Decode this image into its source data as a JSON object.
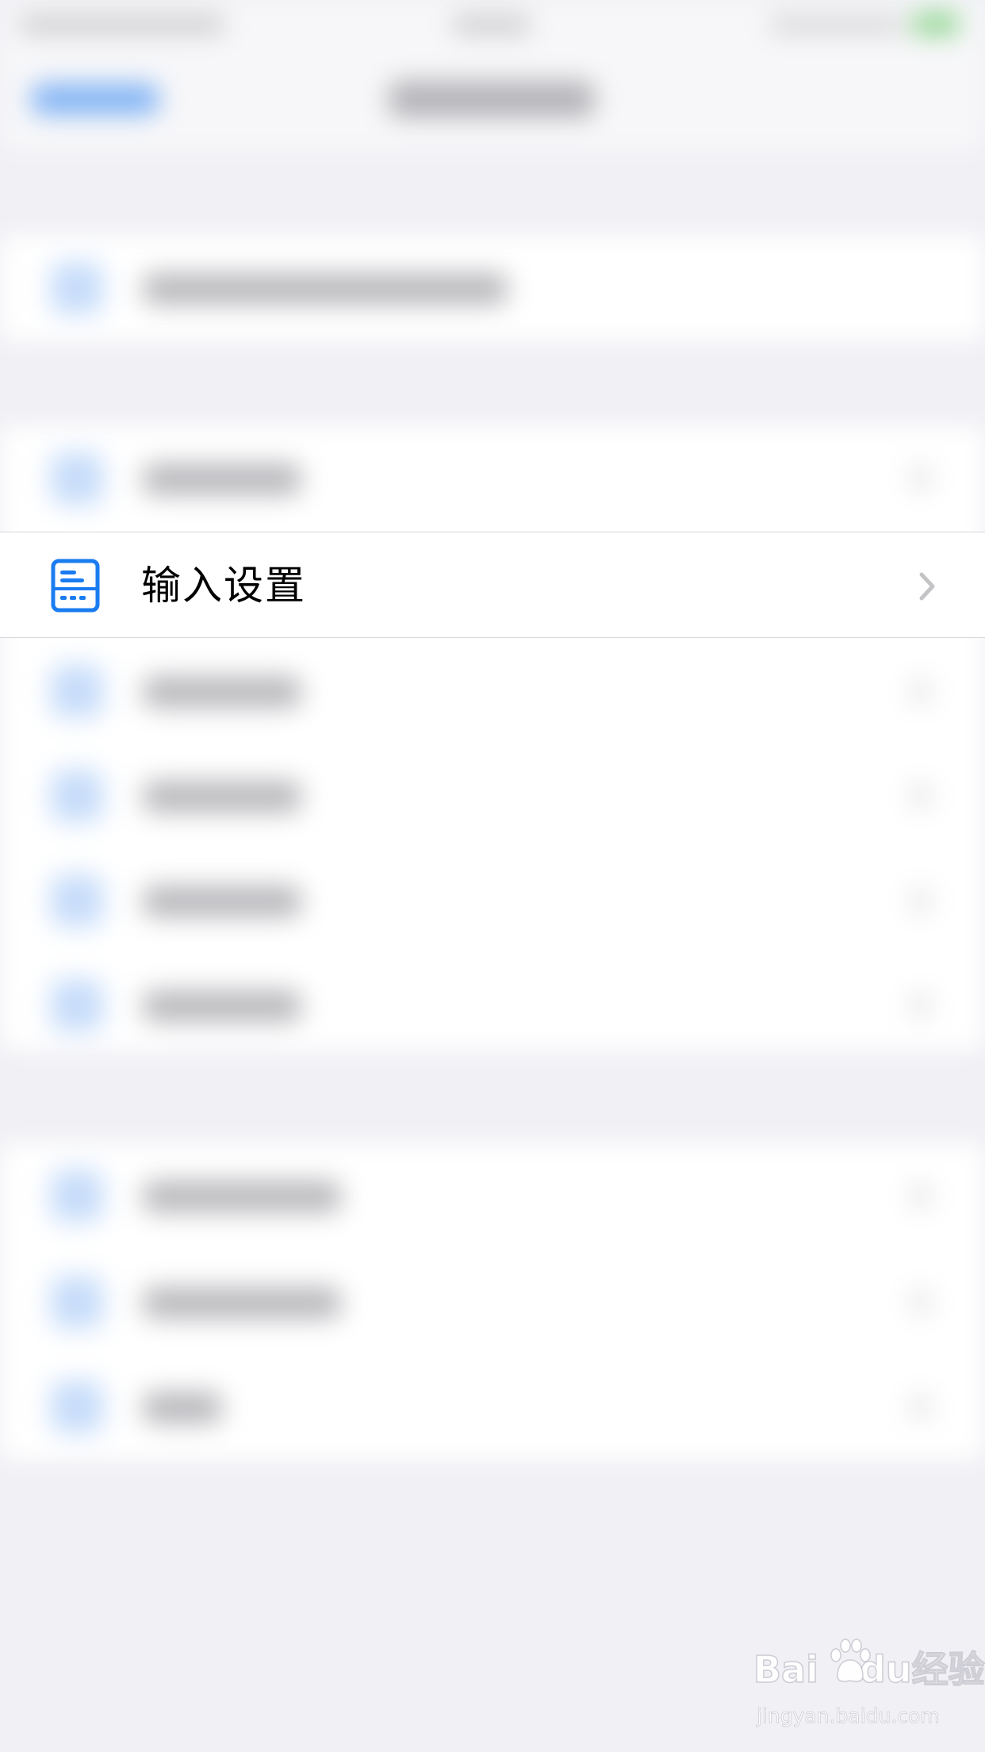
{
  "focused_row": {
    "label": "输入设置",
    "icon": "keyboard-settings-icon",
    "chevron_icon": "chevron-right-icon"
  },
  "colors": {
    "accent": "#1a7cf0",
    "background": "#f0f0f5",
    "row_background": "#ffffff",
    "text": "#000000",
    "chevron": "#c4c4c6"
  },
  "watermark": {
    "brand": "Bai",
    "brand_suffix": "du",
    "product": "经验",
    "url": "jingyan.baidu.com"
  }
}
